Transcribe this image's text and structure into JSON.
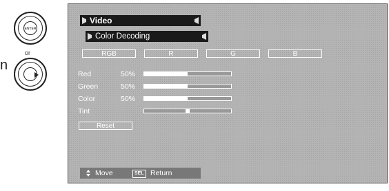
{
  "remote": {
    "top_button_label": "ENTER",
    "or_label": "or",
    "stray_char": "n"
  },
  "menu": {
    "title": "Video",
    "submenu": "Color Decoding",
    "tabs": [
      "RGB",
      "R",
      "G",
      "B"
    ],
    "rows": [
      {
        "label": "Red",
        "value": "50%",
        "level": 0.5
      },
      {
        "label": "Green",
        "value": "50%",
        "level": 0.5
      },
      {
        "label": "Color",
        "value": "50%",
        "level": 0.5
      },
      {
        "label": "Tint",
        "value": "",
        "level": 0.5
      }
    ],
    "reset_label": "Reset"
  },
  "help": {
    "move_label": "Move",
    "sel_key": "SEL",
    "return_label": "Return"
  }
}
